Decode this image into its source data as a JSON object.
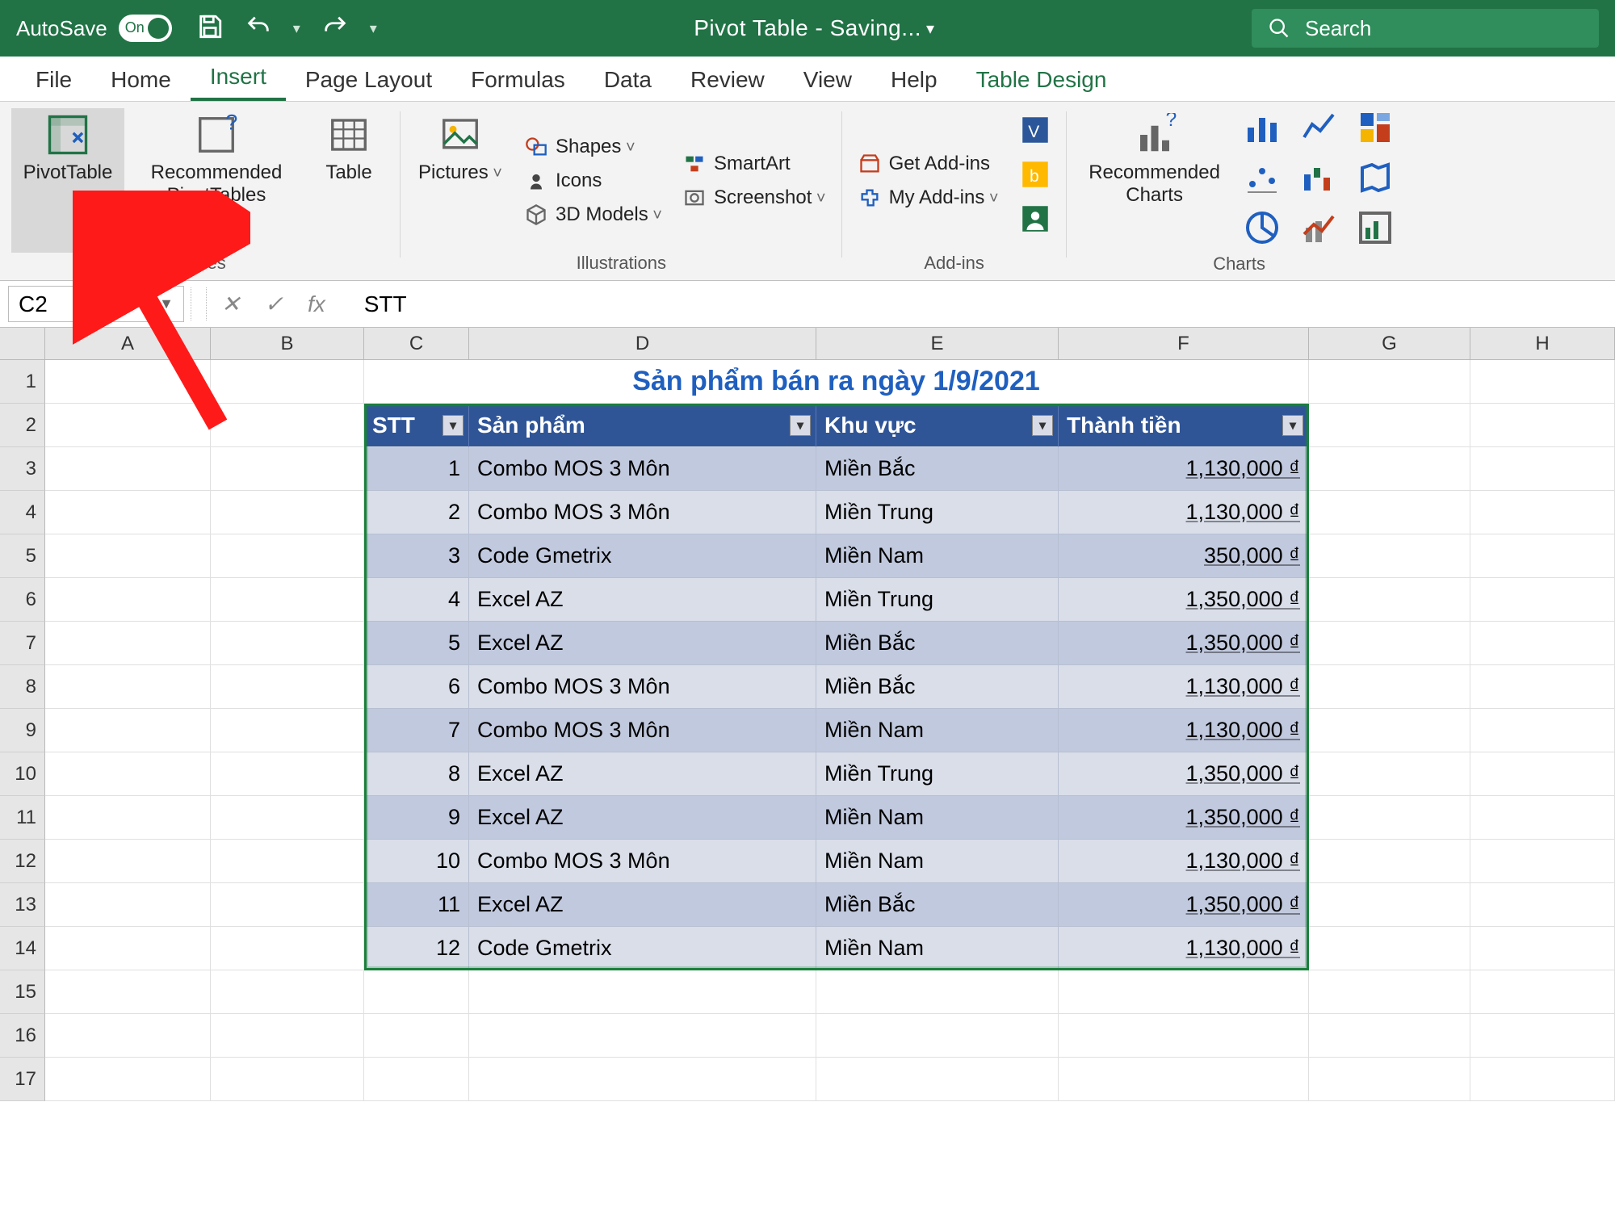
{
  "titlebar": {
    "autosave_label": "AutoSave",
    "autosave_state": "On",
    "doc_title": "Pivot Table  -  Saving...",
    "search_placeholder": "Search"
  },
  "tabs": {
    "file": "File",
    "home": "Home",
    "insert": "Insert",
    "page_layout": "Page Layout",
    "formulas": "Formulas",
    "data": "Data",
    "review": "Review",
    "view": "View",
    "help": "Help",
    "table_design": "Table Design"
  },
  "ribbon": {
    "tables": {
      "pivot_table": "PivotTable",
      "rec_pivot": "Recommended PivotTables",
      "table": "Table",
      "label": "Tables"
    },
    "illustrations": {
      "pictures": "Pictures",
      "shapes": "Shapes",
      "icons": "Icons",
      "models3d": "3D Models",
      "smartart": "SmartArt",
      "screenshot": "Screenshot",
      "label": "Illustrations"
    },
    "addins": {
      "get": "Get Add-ins",
      "my": "My Add-ins",
      "label": "Add-ins"
    },
    "charts": {
      "recommended": "Recommended Charts",
      "label": "Charts"
    }
  },
  "formula_bar": {
    "name_box": "C2",
    "formula": "STT"
  },
  "col_headers": [
    "A",
    "B",
    "C",
    "D",
    "E",
    "F",
    "G",
    "H"
  ],
  "table_title": "Sản phẩm bán ra ngày 1/9/2021",
  "headers": {
    "stt": "STT",
    "sp": "Sản phẩm",
    "kv": "Khu vực",
    "tt": "Thành tiền"
  },
  "rows": [
    {
      "stt": "1",
      "sp": "Combo MOS 3 Môn",
      "kv": "Miền Bắc",
      "tt": "1,130,000 ₫"
    },
    {
      "stt": "2",
      "sp": "Combo MOS 3 Môn",
      "kv": "Miền Trung",
      "tt": "1,130,000 ₫"
    },
    {
      "stt": "3",
      "sp": "Code Gmetrix",
      "kv": "Miền Nam",
      "tt": "350,000 ₫"
    },
    {
      "stt": "4",
      "sp": "Excel AZ",
      "kv": "Miền Trung",
      "tt": "1,350,000 ₫"
    },
    {
      "stt": "5",
      "sp": "Excel AZ",
      "kv": "Miền Bắc",
      "tt": "1,350,000 ₫"
    },
    {
      "stt": "6",
      "sp": "Combo MOS 3 Môn",
      "kv": "Miền Bắc",
      "tt": "1,130,000 ₫"
    },
    {
      "stt": "7",
      "sp": "Combo MOS 3 Môn",
      "kv": "Miền Nam",
      "tt": "1,130,000 ₫"
    },
    {
      "stt": "8",
      "sp": "Excel AZ",
      "kv": "Miền Trung",
      "tt": "1,350,000 ₫"
    },
    {
      "stt": "9",
      "sp": "Excel AZ",
      "kv": "Miền Nam",
      "tt": "1,350,000 ₫"
    },
    {
      "stt": "10",
      "sp": "Combo MOS 3 Môn",
      "kv": "Miền Nam",
      "tt": "1,130,000 ₫"
    },
    {
      "stt": "11",
      "sp": "Excel AZ",
      "kv": "Miền Bắc",
      "tt": "1,350,000 ₫"
    },
    {
      "stt": "12",
      "sp": "Code Gmetrix",
      "kv": "Miền Nam",
      "tt": "1,130,000 ₫"
    }
  ]
}
